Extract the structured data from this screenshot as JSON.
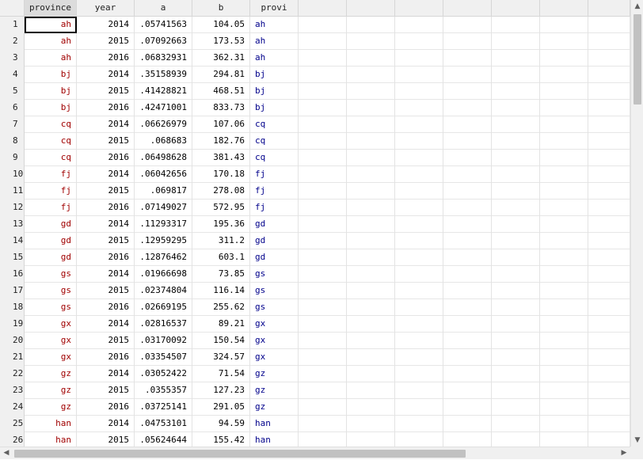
{
  "columns": [
    "province",
    "year",
    "a",
    "b",
    "provi"
  ],
  "selected_column": "province",
  "rows": [
    {
      "n": "1",
      "province": "ah",
      "year": "2014",
      "a": ".05741563",
      "b": "104.05",
      "provi": "ah"
    },
    {
      "n": "2",
      "province": "ah",
      "year": "2015",
      "a": ".07092663",
      "b": "173.53",
      "provi": "ah"
    },
    {
      "n": "3",
      "province": "ah",
      "year": "2016",
      "a": ".06832931",
      "b": "362.31",
      "provi": "ah"
    },
    {
      "n": "4",
      "province": "bj",
      "year": "2014",
      "a": ".35158939",
      "b": "294.81",
      "provi": "bj"
    },
    {
      "n": "5",
      "province": "bj",
      "year": "2015",
      "a": ".41428821",
      "b": "468.51",
      "provi": "bj"
    },
    {
      "n": "6",
      "province": "bj",
      "year": "2016",
      "a": ".42471001",
      "b": "833.73",
      "provi": "bj"
    },
    {
      "n": "7",
      "province": "cq",
      "year": "2014",
      "a": ".06626979",
      "b": "107.06",
      "provi": "cq"
    },
    {
      "n": "8",
      "province": "cq",
      "year": "2015",
      "a": ".068683",
      "b": "182.76",
      "provi": "cq"
    },
    {
      "n": "9",
      "province": "cq",
      "year": "2016",
      "a": ".06498628",
      "b": "381.43",
      "provi": "cq"
    },
    {
      "n": "10",
      "province": "fj",
      "year": "2014",
      "a": ".06042656",
      "b": "170.18",
      "provi": "fj"
    },
    {
      "n": "11",
      "province": "fj",
      "year": "2015",
      "a": ".069817",
      "b": "278.08",
      "provi": "fj"
    },
    {
      "n": "12",
      "province": "fj",
      "year": "2016",
      "a": ".07149027",
      "b": "572.95",
      "provi": "fj"
    },
    {
      "n": "13",
      "province": "gd",
      "year": "2014",
      "a": ".11293317",
      "b": "195.36",
      "provi": "gd"
    },
    {
      "n": "14",
      "province": "gd",
      "year": "2015",
      "a": ".12959295",
      "b": "311.2",
      "provi": "gd"
    },
    {
      "n": "15",
      "province": "gd",
      "year": "2016",
      "a": ".12876462",
      "b": "603.1",
      "provi": "gd"
    },
    {
      "n": "16",
      "province": "gs",
      "year": "2014",
      "a": ".01966698",
      "b": "73.85",
      "provi": "gs"
    },
    {
      "n": "17",
      "province": "gs",
      "year": "2015",
      "a": ".02374804",
      "b": "116.14",
      "provi": "gs"
    },
    {
      "n": "18",
      "province": "gs",
      "year": "2016",
      "a": ".02669195",
      "b": "255.62",
      "provi": "gs"
    },
    {
      "n": "19",
      "province": "gx",
      "year": "2014",
      "a": ".02816537",
      "b": "89.21",
      "provi": "gx"
    },
    {
      "n": "20",
      "province": "gx",
      "year": "2015",
      "a": ".03170092",
      "b": "150.54",
      "provi": "gx"
    },
    {
      "n": "21",
      "province": "gx",
      "year": "2016",
      "a": ".03354507",
      "b": "324.57",
      "provi": "gx"
    },
    {
      "n": "22",
      "province": "gz",
      "year": "2014",
      "a": ".03052422",
      "b": "71.54",
      "provi": "gz"
    },
    {
      "n": "23",
      "province": "gz",
      "year": "2015",
      "a": ".0355357",
      "b": "127.23",
      "provi": "gz"
    },
    {
      "n": "24",
      "province": "gz",
      "year": "2016",
      "a": ".03725141",
      "b": "291.05",
      "provi": "gz"
    },
    {
      "n": "25",
      "province": "han",
      "year": "2014",
      "a": ".04753101",
      "b": "94.59",
      "provi": "han"
    },
    {
      "n": "26",
      "province": "han",
      "year": "2015",
      "a": ".05624644",
      "b": "155.42",
      "provi": "han"
    }
  ],
  "scrollbars": {
    "up_icon": "chevron-up-icon",
    "down_icon": "chevron-down-icon",
    "left_icon": "chevron-left-icon",
    "right_icon": "chevron-right-icon"
  },
  "colors": {
    "string_value": "#a00000",
    "string_value_alt": "#00008b",
    "header_bg": "#f0f0f0"
  }
}
